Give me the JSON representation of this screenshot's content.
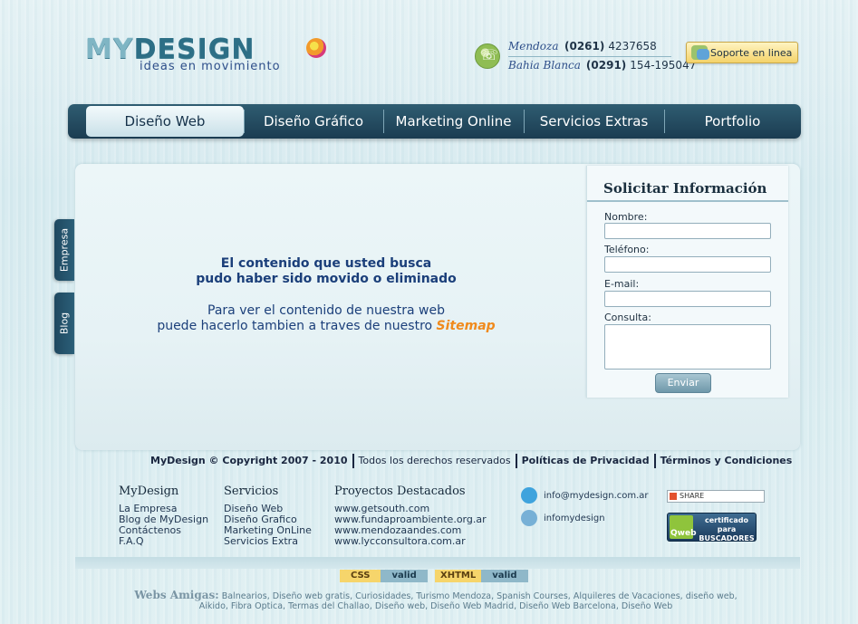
{
  "header": {
    "logo": {
      "word1": "MY",
      "word2": "DESIGN",
      "tagline": "ideas en movimiento"
    },
    "phones": [
      {
        "city": "Mendoza",
        "area": "(0261)",
        "number": "4237658"
      },
      {
        "city": "Bahia Blanca",
        "area": "(0291)",
        "number": "154-195047"
      }
    ],
    "support_label": "Soporte en linea"
  },
  "nav": {
    "items": [
      {
        "label": "Diseño Web"
      },
      {
        "label": "Diseño Gráfico"
      },
      {
        "label": "Marketing Online"
      },
      {
        "label": "Servicios Extras"
      },
      {
        "label": "Portfolio"
      }
    ]
  },
  "side_tabs": [
    {
      "label": "Empresa"
    },
    {
      "label": "Blog"
    }
  ],
  "main": {
    "error_line1": "El contenido que usted busca",
    "error_line2": "pudo haber sido movido o eliminado",
    "info_line1": "Para ver el contenido de nuestra web",
    "info_line2": "puede hacerlo tambien a traves de nuestro",
    "sitemap_link": "Sitemap"
  },
  "form": {
    "title": "Solicitar Información",
    "fields": [
      {
        "label": "Nombre:",
        "value": ""
      },
      {
        "label": "Teléfono:",
        "value": ""
      },
      {
        "label": "E-mail:",
        "value": ""
      },
      {
        "label": "Consulta:",
        "value": ""
      }
    ],
    "submit": "Enviar"
  },
  "footer": {
    "copyright": "MyDesign © Copyright 2007 - 2010",
    "rights": "Todos los derechos reservados",
    "privacy": "Políticas de Privacidad",
    "terms": "Términos y Condiciones",
    "columns": [
      {
        "title": "MyDesign",
        "links": [
          "La Empresa",
          "Blog de MyDesign",
          "Contáctenos",
          "F.A.Q"
        ]
      },
      {
        "title": "Servicios",
        "links": [
          "Diseño Web",
          "Diseño Grafico",
          "Marketing OnLine",
          "Servicios Extra"
        ]
      },
      {
        "title": "Proyectos Destacados",
        "links": [
          "www.getsouth.com",
          "www.fundaproambiente.org.ar",
          "www.mendozaandes.com",
          "www.lycconsultora.com.ar"
        ]
      }
    ],
    "contacts": [
      {
        "icon": "skype-icon",
        "text": "info@mydesign.com.ar"
      },
      {
        "icon": "messenger-icon",
        "text": "infomydesign"
      }
    ],
    "share_label": "SHARE",
    "qweb": {
      "line1": "certificado para",
      "line2": "BUSCADORES",
      "brand": "Qweb"
    },
    "validators": [
      {
        "name": "CSS",
        "status": "valid"
      },
      {
        "name": "XHTML",
        "status": "valid"
      }
    ],
    "friends_label": "Webs Amigas:",
    "friends_text": "Balnearios, Diseño web gratis, Curiosidades, Turismo Mendoza, Spanish Courses, Alquileres de Vacaciones, diseño web, Aikido, Fibra Optica, Termas del Challao, Diseño web, Diseño Web Madrid, Diseño Web Barcelona, Diseño Web"
  }
}
